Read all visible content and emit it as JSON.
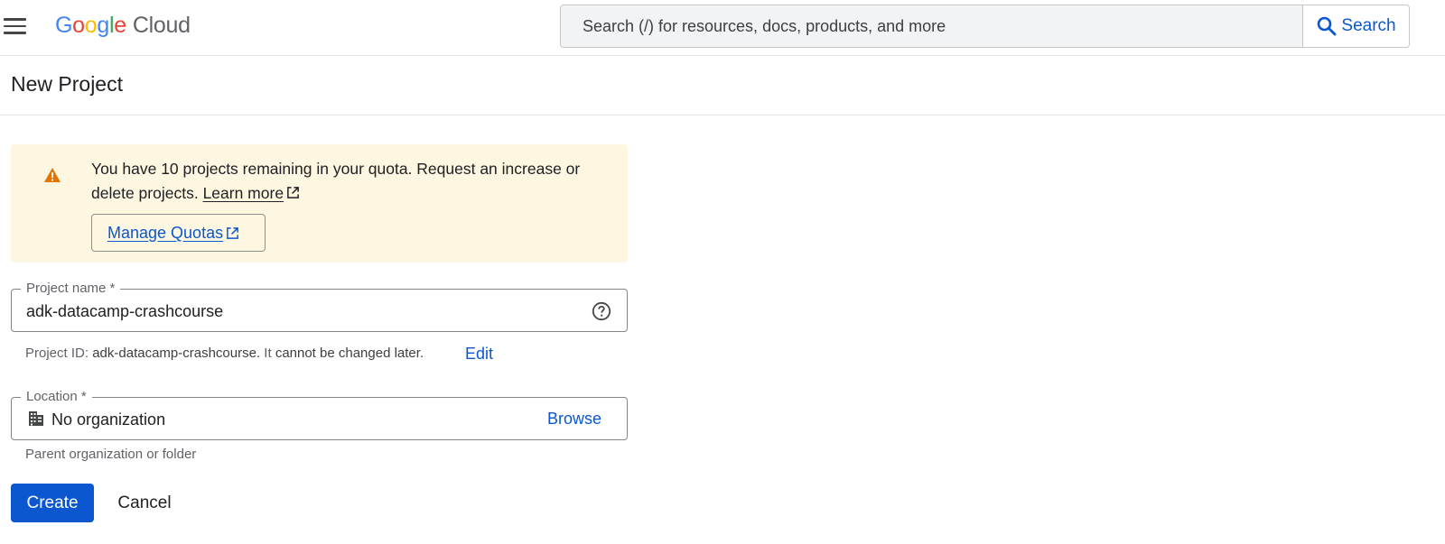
{
  "header": {
    "logo_google_letters": [
      "G",
      "o",
      "o",
      "g",
      "l",
      "e"
    ],
    "logo_cloud": "Cloud",
    "search_placeholder": "Search (/) for resources, docs, products, and more",
    "search_button": "Search"
  },
  "page": {
    "title": "New Project"
  },
  "banner": {
    "message": "You have 10 projects remaining in your quota. Request an increase or delete projects.",
    "learn_more": "Learn more",
    "manage_quotas": "Manage Quotas"
  },
  "project_name": {
    "label": "Project name *",
    "value": "adk-datacamp-crashcourse",
    "id_prefix": "Project ID:",
    "id_value": "adk-datacamp-crashcourse.",
    "id_mid": "It",
    "id_suffix": "cannot be changed later.",
    "edit": "Edit"
  },
  "location": {
    "label": "Location *",
    "value": "No organization",
    "browse": "Browse",
    "hint": "Parent organization or folder"
  },
  "actions": {
    "create": "Create",
    "cancel": "Cancel"
  },
  "colors": {
    "primary": "#0b57d0",
    "banner_bg": "#fdf6e0",
    "warning": "#e37400"
  }
}
